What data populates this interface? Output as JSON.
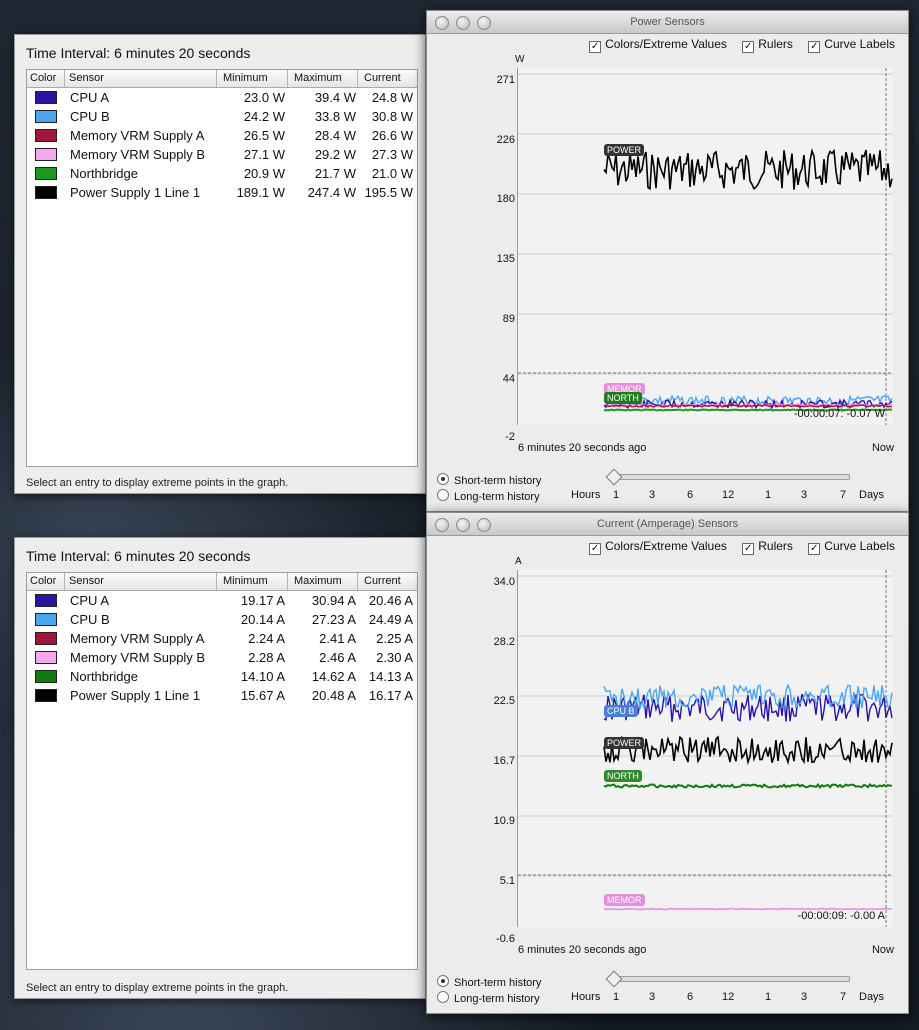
{
  "panels": [
    {
      "interval": "Time Interval: 6 minutes 20 seconds",
      "headers": [
        "Color",
        "Sensor",
        "Minimum",
        "Maximum",
        "Current"
      ],
      "rows": [
        {
          "color": "#2a13a6",
          "sensor": "CPU A",
          "min": "23.0 W",
          "max": "39.4 W",
          "cur": "24.8 W"
        },
        {
          "color": "#49a6ef",
          "sensor": "CPU B",
          "min": "24.2 W",
          "max": "33.8 W",
          "cur": "30.8 W"
        },
        {
          "color": "#a0173e",
          "sensor": "Memory VRM Supply A",
          "min": "26.5 W",
          "max": "28.4 W",
          "cur": "26.6 W"
        },
        {
          "color": "#f5a8ee",
          "sensor": "Memory VRM Supply B",
          "min": "27.1 W",
          "max": "29.2 W",
          "cur": "27.3 W"
        },
        {
          "color": "#1d9a1d",
          "sensor": "Northbridge",
          "min": "20.9 W",
          "max": "21.7 W",
          "cur": "21.0 W"
        },
        {
          "color": "#000000",
          "sensor": "Power Supply 1 Line 1",
          "min": "189.1 W",
          "max": "247.4 W",
          "cur": "195.5 W"
        }
      ],
      "footer": "Select an entry to display extreme points in the graph."
    },
    {
      "interval": "Time Interval: 6 minutes 20 seconds",
      "headers": [
        "Color",
        "Sensor",
        "Minimum",
        "Maximum",
        "Current"
      ],
      "rows": [
        {
          "color": "#2a13a6",
          "sensor": "CPU A",
          "min": "19.17 A",
          "max": "30.94 A",
          "cur": "20.46 A"
        },
        {
          "color": "#49a6ef",
          "sensor": "CPU B",
          "min": "20.14 A",
          "max": "27.23 A",
          "cur": "24.49 A"
        },
        {
          "color": "#a0173e",
          "sensor": "Memory VRM Supply A",
          "min": "2.24 A",
          "max": "2.41 A",
          "cur": "2.25 A"
        },
        {
          "color": "#f5a8ee",
          "sensor": "Memory VRM Supply B",
          "min": "2.28 A",
          "max": "2.46 A",
          "cur": "2.30 A"
        },
        {
          "color": "#127a12",
          "sensor": "Northbridge",
          "min": "14.10 A",
          "max": "14.62 A",
          "cur": "14.13 A"
        },
        {
          "color": "#000000",
          "sensor": "Power Supply 1 Line 1",
          "min": "15.67 A",
          "max": "20.48 A",
          "cur": "16.17 A"
        }
      ],
      "footer": "Select an entry to display extreme points in the graph."
    }
  ],
  "windows": [
    {
      "title": "Power Sensors",
      "options": {
        "colors": "Colors/Extreme Values",
        "rulers": "Rulers",
        "labels": "Curve Labels"
      },
      "unit": "W",
      "ticks": [
        "271",
        "226",
        "180",
        "135",
        "89",
        "44",
        "-2"
      ],
      "range_label": "6 minutes 20 seconds ago",
      "now": "Now",
      "cursor": "-00:00:07: -0.07 W",
      "short": "Short-term history",
      "long": "Long-term history",
      "hours": "Hours",
      "days": "Days",
      "scale": [
        "1",
        "3",
        "6",
        "12",
        "1",
        "3",
        "7"
      ],
      "curve_labels": {
        "power": "POWER",
        "memor": "MEMOR",
        "north": "NORTH"
      }
    },
    {
      "title": "Current (Amperage) Sensors",
      "options": {
        "colors": "Colors/Extreme Values",
        "rulers": "Rulers",
        "labels": "Curve Labels"
      },
      "unit": "A",
      "ticks": [
        "34.0",
        "28.2",
        "22.5",
        "16.7",
        "10.9",
        "5.1",
        "-0.6"
      ],
      "range_label": "6 minutes 20 seconds ago",
      "now": "Now",
      "cursor": "-00:00:09: -0.00 A",
      "short": "Short-term history",
      "long": "Long-term history",
      "hours": "Hours",
      "days": "Days",
      "scale": [
        "1",
        "3",
        "6",
        "12",
        "1",
        "3",
        "7"
      ],
      "curve_labels": {
        "cpub": "CPU B",
        "power": "POWER",
        "north": "NORTH",
        "memor": "MEMOR"
      }
    }
  ]
}
